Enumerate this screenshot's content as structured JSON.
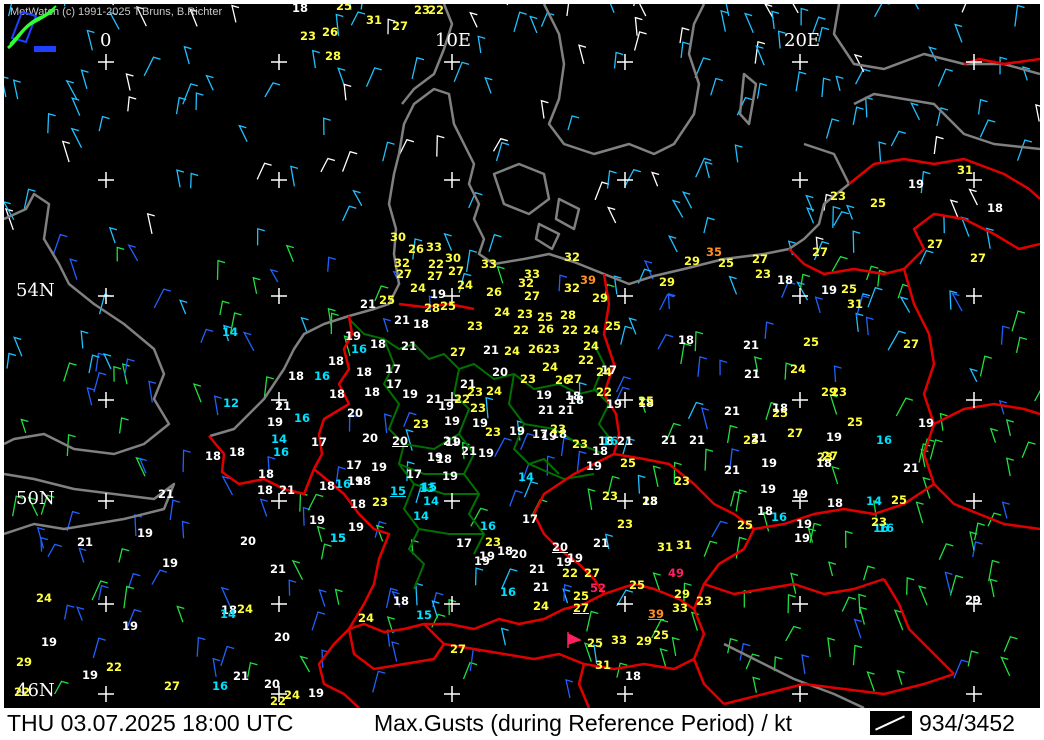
{
  "header": {
    "copyright": "MetWatch  (c) 1991-2025 T.Bruns, B.Richter",
    "logo_icon": "metwatch-logo-icon"
  },
  "footer": {
    "datetime": "THU 03.07.2025 18:00 UTC",
    "title": "Max.Gusts (during Reference Period) / kt",
    "station_count": "934/3452",
    "legend_icon": "wind-barb-legend-icon"
  },
  "grid_labels": {
    "lon_0": "0",
    "lon_10e": "10E",
    "lon_20e": "20E",
    "lat_54n": "54N",
    "lat_50n": "50N",
    "lat_46n": "46N"
  },
  "colors": {
    "background": "#000000",
    "coastline": "#808080",
    "border": "#e00000",
    "state_border": "#007000",
    "grid": "#ffffff",
    "gust_cyan": "#00e0ff",
    "gust_white": "#ffffff",
    "gust_yellow": "#ffff40",
    "gust_orange": "#ff9020",
    "gust_red": "#ff2060"
  },
  "stations": [
    {
      "v": "18",
      "c": "w"
    },
    {
      "v": "25",
      "c": "y"
    },
    {
      "v": "31",
      "c": "y"
    },
    {
      "v": "27",
      "c": "y"
    },
    {
      "v": "23",
      "c": "y"
    },
    {
      "v": "22",
      "c": "y"
    },
    {
      "v": "23",
      "c": "y"
    },
    {
      "v": "26",
      "c": "y"
    },
    {
      "v": "28",
      "c": "y"
    },
    {
      "v": "23",
      "c": "y"
    },
    {
      "v": "25",
      "c": "y"
    },
    {
      "v": "19",
      "c": "w"
    },
    {
      "v": "31",
      "c": "y"
    },
    {
      "v": "18",
      "c": "w"
    },
    {
      "v": "27",
      "c": "y"
    },
    {
      "v": "27",
      "c": "y"
    },
    {
      "v": "30",
      "c": "y"
    },
    {
      "v": "26",
      "c": "y"
    },
    {
      "v": "33",
      "c": "y"
    },
    {
      "v": "32",
      "c": "y"
    },
    {
      "v": "22",
      "c": "y"
    },
    {
      "v": "30",
      "c": "y"
    },
    {
      "v": "33",
      "c": "y"
    },
    {
      "v": "32",
      "c": "y"
    },
    {
      "v": "35",
      "c": "o"
    },
    {
      "v": "27",
      "c": "y"
    },
    {
      "v": "27",
      "c": "y"
    },
    {
      "v": "27",
      "c": "y"
    },
    {
      "v": "27",
      "c": "y"
    },
    {
      "v": "33",
      "c": "y"
    },
    {
      "v": "39",
      "c": "o"
    },
    {
      "v": "29",
      "c": "y"
    },
    {
      "v": "25",
      "c": "y"
    },
    {
      "v": "23",
      "c": "y"
    },
    {
      "v": "18",
      "c": "w"
    },
    {
      "v": "27",
      "c": "y"
    },
    {
      "v": "24",
      "c": "y"
    },
    {
      "v": "19",
      "c": "w"
    },
    {
      "v": "24",
      "c": "y"
    },
    {
      "v": "26",
      "c": "y"
    },
    {
      "v": "32",
      "c": "y"
    },
    {
      "v": "32",
      "c": "y"
    },
    {
      "v": "29",
      "c": "y"
    },
    {
      "v": "29",
      "c": "y"
    },
    {
      "v": "25",
      "c": "y"
    },
    {
      "v": "31",
      "c": "y"
    },
    {
      "v": "25",
      "c": "y"
    },
    {
      "v": "21",
      "c": "w"
    },
    {
      "v": "28",
      "c": "y"
    },
    {
      "v": "25",
      "c": "y"
    },
    {
      "v": "27",
      "c": "y"
    },
    {
      "v": "14",
      "c": "c"
    },
    {
      "v": "21",
      "c": "w"
    },
    {
      "v": "18",
      "c": "w"
    },
    {
      "v": "23",
      "c": "y"
    },
    {
      "v": "24",
      "c": "y"
    },
    {
      "v": "23",
      "c": "y"
    },
    {
      "v": "25",
      "c": "y"
    },
    {
      "v": "28",
      "c": "y"
    },
    {
      "v": "25",
      "c": "y"
    },
    {
      "v": "22",
      "c": "y"
    },
    {
      "v": "26",
      "c": "y"
    },
    {
      "v": "22",
      "c": "y"
    },
    {
      "v": "24",
      "c": "y"
    },
    {
      "v": "19",
      "c": "w"
    },
    {
      "v": "18",
      "c": "w"
    },
    {
      "v": "21",
      "c": "w"
    },
    {
      "v": "16",
      "c": "c"
    },
    {
      "v": "27",
      "c": "y"
    },
    {
      "v": "21",
      "c": "w"
    },
    {
      "v": "24",
      "c": "y"
    },
    {
      "v": "26",
      "c": "y"
    },
    {
      "v": "23",
      "c": "y"
    },
    {
      "v": "24",
      "c": "y"
    },
    {
      "v": "22",
      "c": "y"
    },
    {
      "v": "18",
      "c": "w"
    },
    {
      "v": "21",
      "c": "w"
    },
    {
      "v": "25",
      "c": "y"
    },
    {
      "v": "18",
      "c": "w"
    },
    {
      "v": "18",
      "c": "w"
    },
    {
      "v": "16",
      "c": "c"
    },
    {
      "v": "17",
      "c": "w"
    },
    {
      "v": "20",
      "c": "w"
    },
    {
      "v": "23",
      "c": "y"
    },
    {
      "v": "24",
      "c": "y"
    },
    {
      "v": "26",
      "c": "y"
    },
    {
      "v": "27",
      "c": "y"
    },
    {
      "v": "18",
      "c": "w"
    },
    {
      "v": "17",
      "c": "w"
    },
    {
      "v": "21",
      "c": "w"
    },
    {
      "v": "19",
      "c": "w"
    },
    {
      "v": "21",
      "c": "w"
    },
    {
      "v": "23",
      "c": "y"
    },
    {
      "v": "24",
      "c": "y"
    },
    {
      "v": "22",
      "c": "y"
    },
    {
      "v": "19",
      "c": "w"
    },
    {
      "v": "18",
      "c": "w"
    },
    {
      "v": "17",
      "c": "w"
    },
    {
      "v": "12",
      "c": "c"
    },
    {
      "v": "21",
      "c": "w"
    },
    {
      "v": "20",
      "c": "w"
    },
    {
      "v": "16",
      "c": "c"
    },
    {
      "v": "18",
      "c": "w"
    },
    {
      "v": "18",
      "c": "w"
    },
    {
      "v": "23",
      "c": "y"
    },
    {
      "v": "19",
      "c": "w"
    },
    {
      "v": "19",
      "c": "w"
    },
    {
      "v": "18",
      "c": "w"
    },
    {
      "v": "21",
      "c": "w"
    },
    {
      "v": "25",
      "c": "y"
    },
    {
      "v": "19",
      "c": "w"
    },
    {
      "v": "14",
      "c": "c"
    },
    {
      "v": "17",
      "c": "w"
    },
    {
      "v": "20",
      "c": "w",
      "u": true
    },
    {
      "v": "23",
      "c": "y"
    },
    {
      "v": "21",
      "c": "w"
    },
    {
      "v": "19",
      "c": "w"
    },
    {
      "v": "23",
      "c": "y"
    },
    {
      "v": "19",
      "c": "w"
    },
    {
      "v": "17",
      "c": "w"
    },
    {
      "v": "18",
      "c": "w"
    },
    {
      "v": "18",
      "c": "w"
    },
    {
      "v": "21",
      "c": "w"
    },
    {
      "v": "23",
      "c": "y"
    },
    {
      "v": "27",
      "c": "y"
    },
    {
      "v": "25",
      "c": "y"
    },
    {
      "v": "16",
      "c": "c"
    },
    {
      "v": "19",
      "c": "w"
    },
    {
      "v": "18",
      "c": "w"
    },
    {
      "v": "18",
      "c": "w"
    },
    {
      "v": "16",
      "c": "c"
    },
    {
      "v": "20",
      "c": "w"
    },
    {
      "v": "18",
      "c": "w"
    },
    {
      "v": "19",
      "c": "w"
    },
    {
      "v": "21",
      "c": "w"
    },
    {
      "v": "19",
      "c": "w"
    },
    {
      "v": "23",
      "c": "y"
    },
    {
      "v": "18",
      "c": "w"
    },
    {
      "v": "25",
      "c": "y"
    },
    {
      "v": "21",
      "c": "w"
    },
    {
      "v": "21",
      "c": "w"
    },
    {
      "v": "17",
      "c": "w"
    },
    {
      "v": "19",
      "c": "w"
    },
    {
      "v": "17",
      "c": "w"
    },
    {
      "v": "19",
      "c": "w"
    },
    {
      "v": "14",
      "c": "c"
    },
    {
      "v": "19",
      "c": "w"
    },
    {
      "v": "18",
      "c": "w"
    },
    {
      "v": "19",
      "c": "w"
    },
    {
      "v": "18",
      "c": "w"
    },
    {
      "v": "16",
      "c": "c"
    },
    {
      "v": "18",
      "c": "w"
    },
    {
      "v": "15",
      "c": "c",
      "u": true
    },
    {
      "v": "15",
      "c": "c"
    },
    {
      "v": "19",
      "c": "w"
    },
    {
      "v": "18",
      "c": "w"
    },
    {
      "v": "21",
      "c": "w"
    },
    {
      "v": "14",
      "c": "c"
    },
    {
      "v": "23",
      "c": "y"
    },
    {
      "v": "21",
      "c": "w"
    },
    {
      "v": "18",
      "c": "w"
    },
    {
      "v": "23",
      "c": "y"
    },
    {
      "v": "13",
      "c": "c"
    },
    {
      "v": "23",
      "c": "y"
    },
    {
      "v": "19",
      "c": "w"
    },
    {
      "v": "14",
      "c": "c"
    },
    {
      "v": "17",
      "c": "w"
    },
    {
      "v": "25",
      "c": "y"
    },
    {
      "v": "18",
      "c": "w"
    },
    {
      "v": "19",
      "c": "w"
    },
    {
      "v": "15",
      "c": "c"
    },
    {
      "v": "16",
      "c": "c"
    },
    {
      "v": "15",
      "c": "c"
    },
    {
      "v": "19",
      "c": "w"
    },
    {
      "v": "16",
      "c": "c"
    },
    {
      "v": "21",
      "c": "w"
    },
    {
      "v": "20",
      "c": "w"
    },
    {
      "v": "17",
      "c": "w"
    },
    {
      "v": "23",
      "c": "y"
    },
    {
      "v": "20",
      "c": "w",
      "u": true
    },
    {
      "v": "21",
      "c": "w"
    },
    {
      "v": "23",
      "c": "y"
    },
    {
      "v": "31",
      "c": "y"
    },
    {
      "v": "18",
      "c": "w"
    },
    {
      "v": "20",
      "c": "w"
    },
    {
      "v": "19",
      "c": "w"
    },
    {
      "v": "19",
      "c": "w"
    },
    {
      "v": "31",
      "c": "y"
    },
    {
      "v": "19",
      "c": "w"
    },
    {
      "v": "21",
      "c": "w"
    },
    {
      "v": "19",
      "c": "w"
    },
    {
      "v": "22",
      "c": "y"
    },
    {
      "v": "27",
      "c": "y"
    },
    {
      "v": "49",
      "c": "r"
    },
    {
      "v": "21",
      "c": "w"
    },
    {
      "v": "25",
      "c": "y"
    },
    {
      "v": "52",
      "c": "r"
    },
    {
      "v": "25",
      "c": "y"
    },
    {
      "v": "29",
      "c": "y"
    },
    {
      "v": "24",
      "c": "y"
    },
    {
      "v": "18",
      "c": "w"
    },
    {
      "v": "16",
      "c": "c"
    },
    {
      "v": "24",
      "c": "y"
    },
    {
      "v": "27",
      "c": "y",
      "u": true
    },
    {
      "v": "33",
      "c": "y"
    },
    {
      "v": "29",
      "c": "w"
    },
    {
      "v": "18",
      "c": "w"
    },
    {
      "v": "24",
      "c": "y"
    },
    {
      "v": "15",
      "c": "c"
    },
    {
      "v": "39",
      "c": "o",
      "u": true
    },
    {
      "v": "19",
      "c": "w"
    },
    {
      "v": "14",
      "c": "c"
    },
    {
      "v": "20",
      "c": "w"
    },
    {
      "v": "25",
      "c": "y"
    },
    {
      "v": "33",
      "c": "y"
    },
    {
      "v": "29",
      "c": "y"
    },
    {
      "v": "25",
      "c": "y"
    },
    {
      "v": "24",
      "c": "y"
    },
    {
      "v": "19",
      "c": "w"
    },
    {
      "v": "27",
      "c": "y"
    },
    {
      "v": "31",
      "c": "y"
    },
    {
      "v": "18",
      "c": "w"
    },
    {
      "v": "29",
      "c": "y"
    },
    {
      "v": "22",
      "c": "y"
    },
    {
      "v": "21",
      "c": "w"
    },
    {
      "v": "20",
      "c": "w"
    },
    {
      "v": "22",
      "c": "y"
    },
    {
      "v": "19",
      "c": "w"
    },
    {
      "v": "16",
      "c": "c"
    },
    {
      "v": "24",
      "c": "y"
    },
    {
      "v": "19",
      "c": "w"
    },
    {
      "v": "22",
      "c": "y"
    },
    {
      "v": "27",
      "c": "y"
    },
    {
      "v": "19",
      "c": "w"
    },
    {
      "v": "21",
      "c": "w"
    },
    {
      "v": "23",
      "c": "y"
    },
    {
      "v": "29",
      "c": "y"
    },
    {
      "v": "24",
      "c": "y"
    },
    {
      "v": "21",
      "c": "w"
    },
    {
      "v": "16",
      "c": "c"
    },
    {
      "v": "19",
      "c": "w"
    },
    {
      "v": "27",
      "c": "y"
    },
    {
      "v": "21",
      "c": "w"
    },
    {
      "v": "23",
      "c": "y"
    },
    {
      "v": "19",
      "c": "w"
    },
    {
      "v": "19",
      "c": "w"
    },
    {
      "v": "19",
      "c": "w"
    },
    {
      "v": "21",
      "c": "w"
    },
    {
      "v": "23",
      "c": "y"
    },
    {
      "v": "18",
      "c": "w"
    },
    {
      "v": "23",
      "c": "y"
    },
    {
      "v": "16",
      "c": "c"
    },
    {
      "v": "22",
      "c": "y"
    },
    {
      "v": "24",
      "c": "y"
    },
    {
      "v": "18",
      "c": "w"
    },
    {
      "v": "19",
      "c": "w"
    },
    {
      "v": "21",
      "c": "w"
    },
    {
      "v": "21",
      "c": "w"
    },
    {
      "v": "19",
      "c": "w"
    },
    {
      "v": "23",
      "c": "y"
    },
    {
      "v": "25",
      "c": "y"
    },
    {
      "v": "21",
      "c": "w"
    },
    {
      "v": "19",
      "c": "w"
    },
    {
      "v": "18",
      "c": "w"
    },
    {
      "v": "25",
      "c": "y"
    },
    {
      "v": "19",
      "c": "w"
    },
    {
      "v": "18",
      "c": "w"
    },
    {
      "v": "14",
      "c": "c"
    },
    {
      "v": "18",
      "c": "w"
    },
    {
      "v": "23",
      "c": "y"
    },
    {
      "v": "16",
      "c": "c"
    },
    {
      "v": "19",
      "c": "w"
    },
    {
      "v": "27",
      "c": "y"
    },
    {
      "v": "21",
      "c": "w"
    },
    {
      "v": "19",
      "c": "w"
    },
    {
      "v": "21",
      "c": "w"
    },
    {
      "v": "24",
      "c": "y"
    },
    {
      "v": "19",
      "c": "w"
    },
    {
      "v": "21",
      "c": "w"
    },
    {
      "v": "19",
      "c": "w"
    }
  ]
}
